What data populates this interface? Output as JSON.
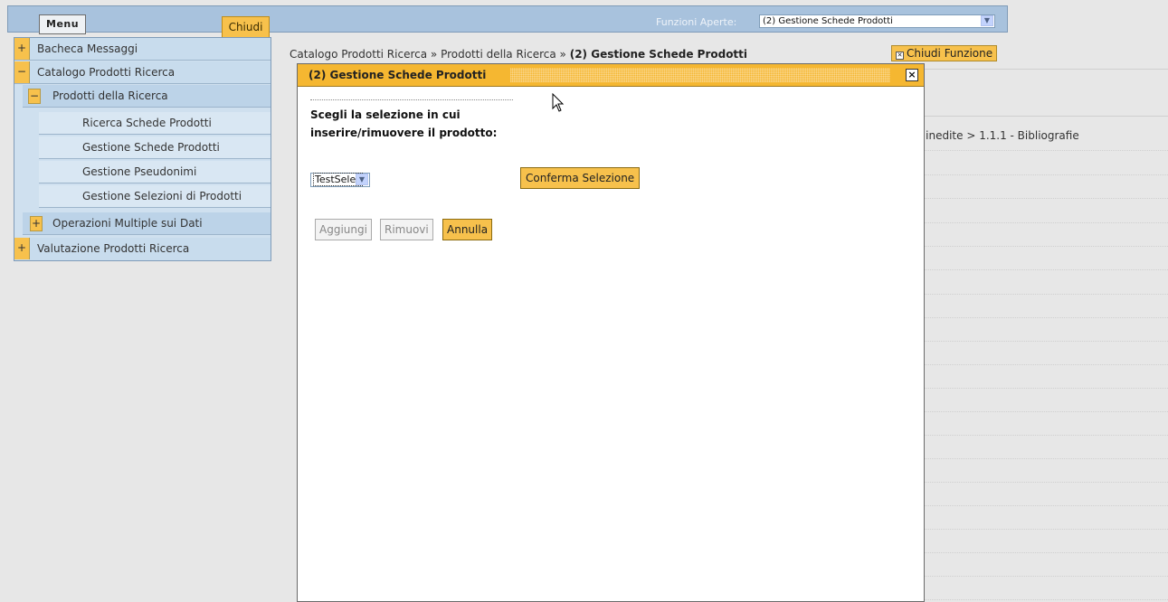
{
  "topbar": {
    "menu_label": "Menu",
    "chiudi_label": "Chiudi",
    "open_functions_label": "Funzioni Aperte:",
    "open_functions_value": "(2) Gestione Schede Prodotti"
  },
  "breadcrumb": {
    "part1": "Catalogo Prodotti Ricerca",
    "sep": " » ",
    "part2": "Prodotti della Ricerca",
    "current": "(2) Gestione Schede Prodotti"
  },
  "close_function_label": "Chiudi Funzione",
  "background_text": "i inedite > 1.1.1 - Bibliografie",
  "sidemenu": {
    "items": [
      {
        "toggle": "+",
        "label": "Bacheca Messaggi"
      },
      {
        "toggle": "−",
        "label": "Catalogo Prodotti Ricerca"
      },
      {
        "toggle": "−",
        "label": "Prodotti della Ricerca"
      },
      {
        "label": "Ricerca Schede Prodotti"
      },
      {
        "label": "Gestione Schede Prodotti"
      },
      {
        "label": "Gestione Pseudonimi"
      },
      {
        "label": "Gestione Selezioni di Prodotti"
      },
      {
        "toggle": "+",
        "label": "Operazioni Multiple sui Dati"
      },
      {
        "toggle": "+",
        "label": "Valutazione Prodotti Ricerca"
      }
    ]
  },
  "dialog": {
    "title": "(2) Gestione Schede Prodotti",
    "close_symbol": "×",
    "question": "Scegli la selezione in cui inserire/rimuovere il prodotto:",
    "selection_value": "TestSelez",
    "confirm_label": "Conferma Selezione",
    "add_label": "Aggiungi",
    "remove_label": "Rimuovi",
    "cancel_label": "Annulla"
  }
}
